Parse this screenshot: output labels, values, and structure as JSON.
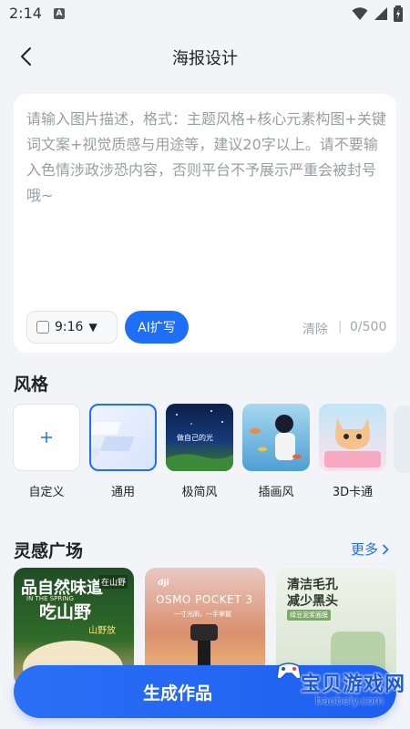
{
  "status_bar": {
    "time": "2:14",
    "notification_icon": "a-icon"
  },
  "header": {
    "title": "海报设计",
    "back_icon": "chevron-left-icon"
  },
  "prompt": {
    "placeholder": "请输入图片描述，格式：主题风格+核心元素构图+关键词文案+视觉质感与用途等，建议20字以上。请不要输入色情涉政涉恐内容，否则平台不予展示严重会被封号哦~",
    "ratio": "9:16",
    "ai_button": "AI扩写",
    "clear": "清除",
    "separator": "|",
    "counter": "0/500"
  },
  "styles": {
    "title": "风格",
    "items": [
      {
        "label": "自定义",
        "icon": "plus-icon"
      },
      {
        "label": "通用"
      },
      {
        "label": "极简风"
      },
      {
        "label": "插画风"
      },
      {
        "label": "3D卡通"
      }
    ]
  },
  "inspiration": {
    "title": "灵感广场",
    "more": "更多",
    "cards": [
      {
        "lines": [
          "品自然味道",
          "吃山野",
          "在山野",
          "IN THE SPRING",
          "山野放"
        ]
      },
      {
        "lines": [
          "OSMO POCKET 3",
          "一寸光阴，一手掌握"
        ]
      },
      {
        "lines": [
          "清洁毛孔",
          "减少黑头",
          "绿豆泥浆面膜"
        ]
      }
    ]
  },
  "generate_button": "生成作品",
  "watermark": {
    "text": "宝贝游戏网",
    "url": "baobeiy.com"
  }
}
